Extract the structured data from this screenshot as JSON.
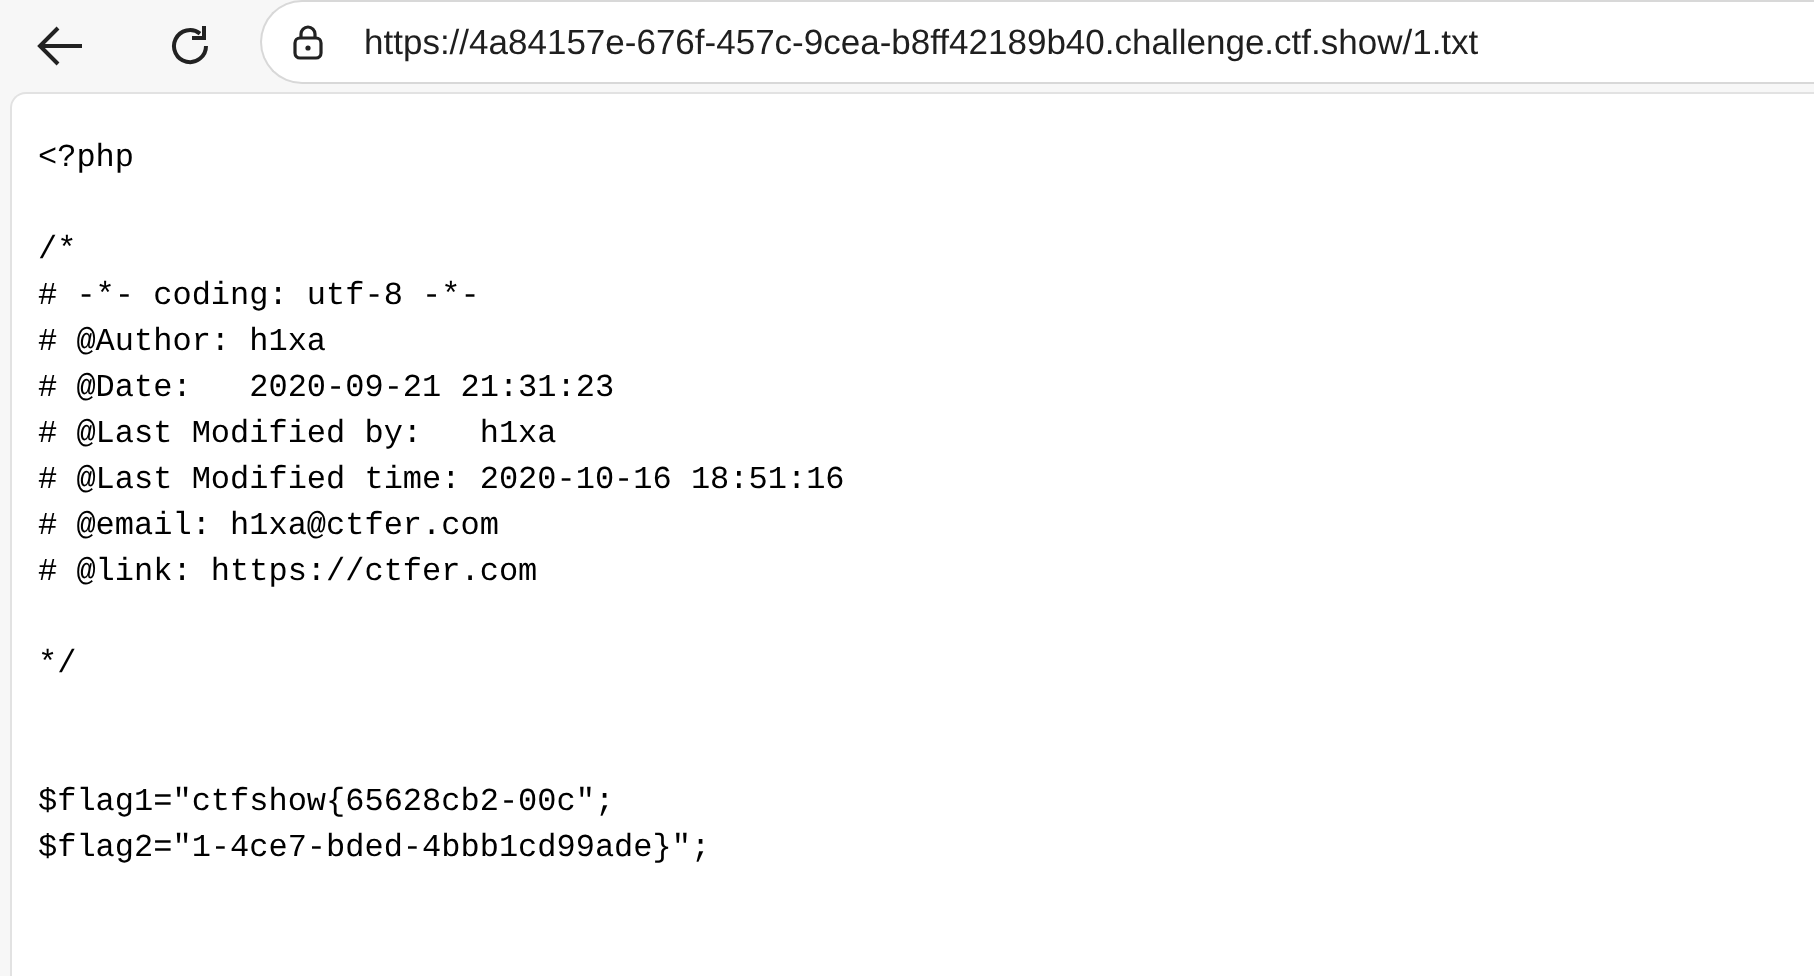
{
  "toolbar": {
    "url": "https://4a84157e-676f-457c-9cea-b8ff42189b40.challenge.ctf.show/1.txt"
  },
  "document": {
    "lines": [
      {
        "kind": "text",
        "text": "<?php"
      },
      {
        "kind": "blank"
      },
      {
        "kind": "text",
        "text": "/*"
      },
      {
        "kind": "text",
        "text": "# -*- coding: utf-8 -*-"
      },
      {
        "kind": "text",
        "text": "# @Author: h1xa"
      },
      {
        "kind": "text",
        "text": "# @Date:   2020-09-21 21:31:23"
      },
      {
        "kind": "text",
        "text": "# @Last Modified by:   h1xa"
      },
      {
        "kind": "text",
        "text": "# @Last Modified time: 2020-10-16 18:51:16"
      },
      {
        "kind": "text",
        "text": "# @email: h1xa@ctfer.com"
      },
      {
        "kind": "text",
        "text": "# @link: https://ctfer.com"
      },
      {
        "kind": "blank"
      },
      {
        "kind": "text",
        "text": "*/"
      },
      {
        "kind": "blank"
      },
      {
        "kind": "blank"
      },
      {
        "kind": "text",
        "text": "$flag1=\"ctfshow{65628cb2-00c\";"
      },
      {
        "kind": "text",
        "text": "$flag2=\"1-4ce7-bded-4bbb1cd99ade}\";"
      }
    ]
  }
}
